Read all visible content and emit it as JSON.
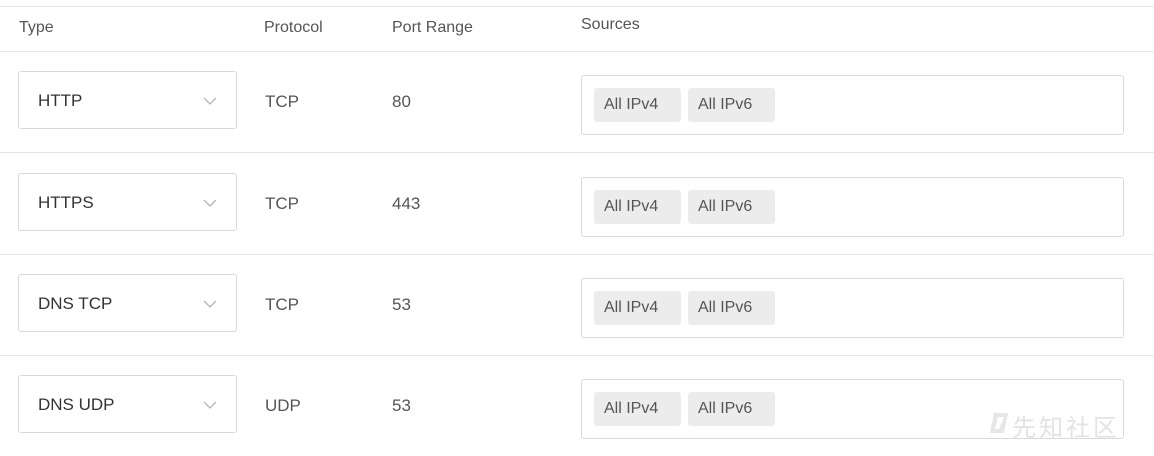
{
  "table": {
    "headers": {
      "type": "Type",
      "protocol": "Protocol",
      "port_range": "Port Range",
      "sources": "Sources"
    },
    "rows": [
      {
        "type": "HTTP",
        "protocol": "TCP",
        "port_range": "80",
        "sources": [
          "All IPv4",
          "All IPv6"
        ]
      },
      {
        "type": "HTTPS",
        "protocol": "TCP",
        "port_range": "443",
        "sources": [
          "All IPv4",
          "All IPv6"
        ]
      },
      {
        "type": "DNS TCP",
        "protocol": "TCP",
        "port_range": "53",
        "sources": [
          "All IPv4",
          "All IPv6"
        ]
      },
      {
        "type": "DNS UDP",
        "protocol": "UDP",
        "port_range": "53",
        "sources": [
          "All IPv4",
          "All IPv6"
        ]
      }
    ]
  },
  "icons": {
    "select_chevron": "chevron-down-icon"
  },
  "watermark": {
    "text": "先知社区"
  },
  "colors": {
    "border": "#d9d9d9",
    "divider": "#e6e6e6",
    "chip_bg": "#ececec",
    "text": "#333333",
    "muted_text": "#555555",
    "watermark": "#e3e3e3"
  }
}
